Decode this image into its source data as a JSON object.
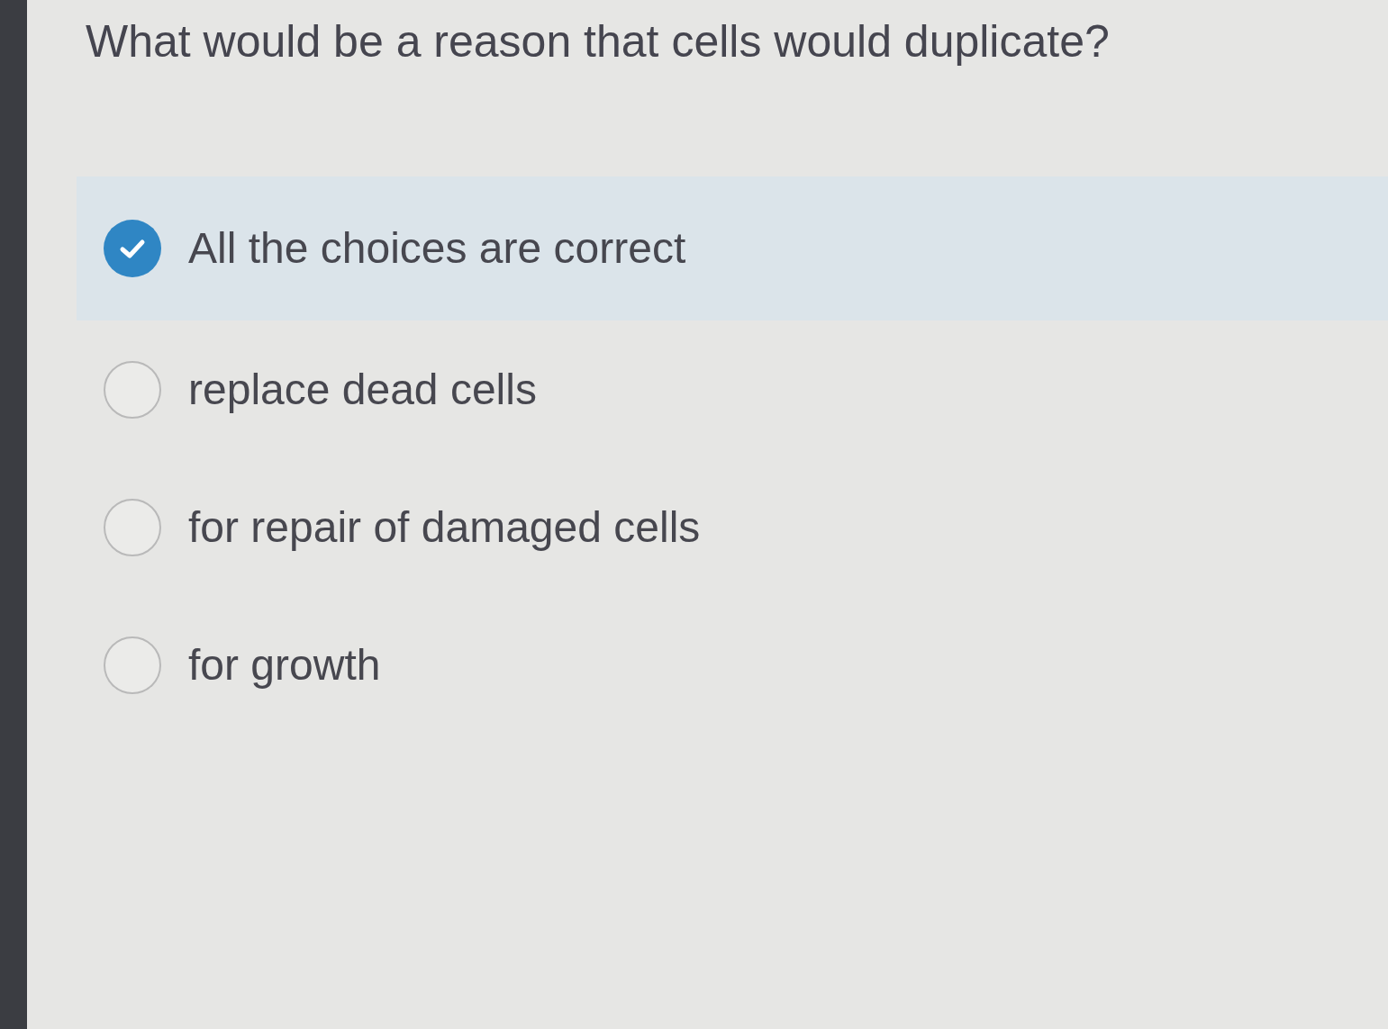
{
  "question": "What would be a reason that cells would duplicate?",
  "choices": [
    {
      "label": "All the choices are correct",
      "selected": true
    },
    {
      "label": "replace dead cells",
      "selected": false
    },
    {
      "label": "for repair of damaged cells",
      "selected": false
    },
    {
      "label": "for growth",
      "selected": false
    }
  ]
}
